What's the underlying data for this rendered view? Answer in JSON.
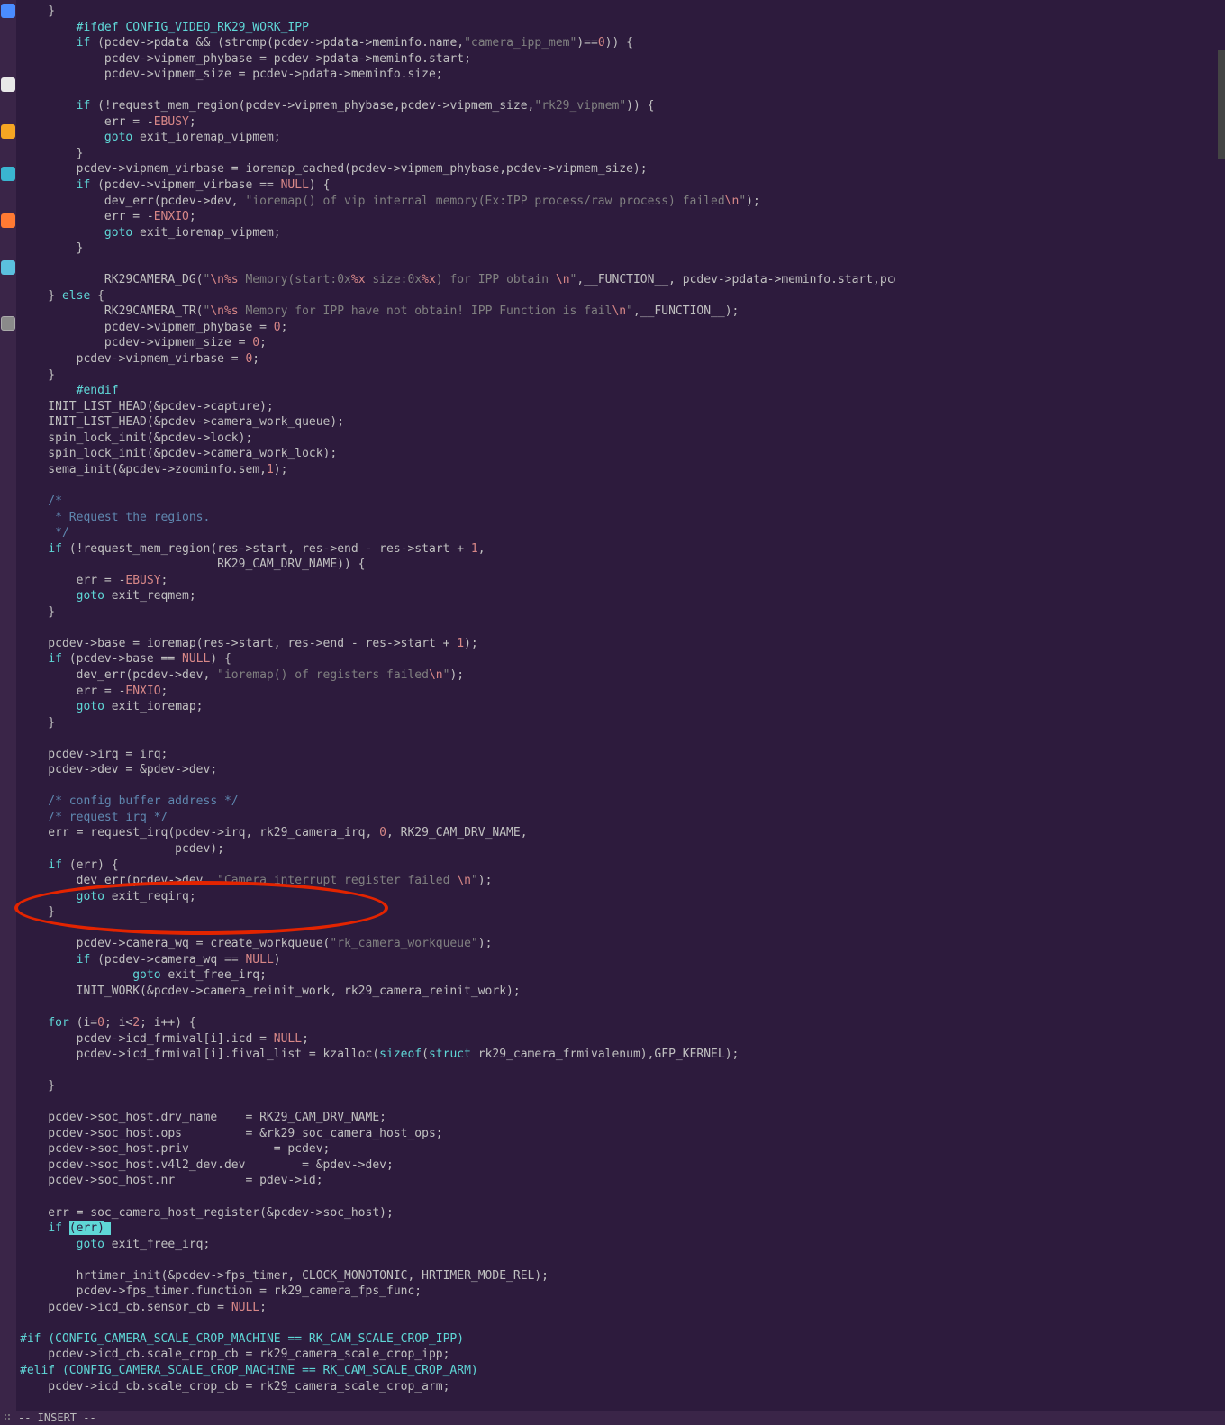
{
  "code": {
    "l01": "    }",
    "l02p": "        ",
    "l02d": "#ifdef",
    "l02s": " CONFIG_VIDEO_RK29_WORK_IPP",
    "l03a": "        ",
    "l03k": "if",
    "l03b": " (pcdev->pdata && (strcmp(pcdev->pdata->meminfo.name,",
    "l03s": "\"camera_ipp_mem\"",
    "l03c": ")==",
    "l03n": "0",
    "l03d": ")) {",
    "l04": "            pcdev->vipmem_phybase = pcdev->pdata->meminfo.start;",
    "l05": "            pcdev->vipmem_size = pcdev->pdata->meminfo.size;",
    "l06": "",
    "l07a": "        ",
    "l07k": "if",
    "l07b": " (!request_mem_region(pcdev->vipmem_phybase,pcdev->vipmem_size,",
    "l07s": "\"rk29_vipmem\"",
    "l07c": ")) {",
    "l08a": "            err = -",
    "l08c": "EBUSY",
    "l08b": ";",
    "l09a": "            ",
    "l09k": "goto",
    "l09b": " exit_ioremap_vipmem;",
    "l10": "        }",
    "l11": "        pcdev->vipmem_virbase = ioremap_cached(pcdev->vipmem_phybase,pcdev->vipmem_size);",
    "l12a": "        ",
    "l12k": "if",
    "l12b": " (pcdev->vipmem_virbase == ",
    "l12c": "NULL",
    "l12d": ") {",
    "l13a": "            dev_err(pcdev->dev, ",
    "l13s": "\"ioremap() of vip internal memory(Ex:IPP process/raw process) failed",
    "l13e": "\\n",
    "l13f": "\"",
    "l13b": ");",
    "l14a": "            err = -",
    "l14c": "ENXIO",
    "l14b": ";",
    "l15a": "            ",
    "l15k": "goto",
    "l15b": " exit_ioremap_vipmem;",
    "l16": "        }",
    "l17": "",
    "l18a": "            RK29CAMERA_DG(",
    "l18s1": "\"",
    "l18e1": "\\n",
    "l18s2": "%s",
    "l18s3": " Memory(start:0x",
    "l18s4": "%x",
    "l18s5": " size:0x",
    "l18s6": "%x",
    "l18s7": ") for IPP obtain ",
    "l18e2": "\\n",
    "l18s8": "\"",
    "l18b": ",__FUNCTION__, pcdev->pdata->meminfo.start,pcdev->pdata->memin",
    "l19a": "    } ",
    "l19k": "else",
    "l19b": " {",
    "l20a": "            RK29CAMERA_TR(",
    "l20s1": "\"",
    "l20e1": "\\n",
    "l20s2": "%s",
    "l20s3": " Memory for IPP have not obtain! IPP Function is fail",
    "l20e2": "\\n",
    "l20s4": "\"",
    "l20b": ",__FUNCTION__);",
    "l21a": "            pcdev->vipmem_phybase = ",
    "l21n": "0",
    "l21b": ";",
    "l22a": "            pcdev->vipmem_size = ",
    "l22n": "0",
    "l22b": ";",
    "l23a": "        pcdev->vipmem_virbase = ",
    "l23n": "0",
    "l23b": ";",
    "l24": "    }",
    "l25a": "        ",
    "l25d": "#endif",
    "l26": "    INIT_LIST_HEAD(&pcdev->capture);",
    "l27": "    INIT_LIST_HEAD(&pcdev->camera_work_queue);",
    "l28": "    spin_lock_init(&pcdev->lock);",
    "l29": "    spin_lock_init(&pcdev->camera_work_lock);",
    "l30a": "    sema_init(&pcdev->zoominfo.sem,",
    "l30n": "1",
    "l30b": ");",
    "l31": "",
    "l32": "    /*",
    "l33": "     * Request the regions.",
    "l34": "     */",
    "l35a": "    ",
    "l35k": "if",
    "l35b": " (!request_mem_region(res->start, res->end - res->start + ",
    "l35n": "1",
    "l35c": ",",
    "l36": "                            RK29_CAM_DRV_NAME)) {",
    "l37a": "        err = -",
    "l37c": "EBUSY",
    "l37b": ";",
    "l38a": "        ",
    "l38k": "goto",
    "l38b": " exit_reqmem;",
    "l39": "    }",
    "l40": "",
    "l41a": "    pcdev->base = ioremap(res->start, res->end - res->start + ",
    "l41n": "1",
    "l41b": ");",
    "l42a": "    ",
    "l42k": "if",
    "l42b": " (pcdev->base == ",
    "l42c": "NULL",
    "l42d": ") {",
    "l43a": "        dev_err(pcdev->dev, ",
    "l43s": "\"ioremap() of registers failed",
    "l43e": "\\n",
    "l43f": "\"",
    "l43b": ");",
    "l44a": "        err = -",
    "l44c": "ENXIO",
    "l44b": ";",
    "l45a": "        ",
    "l45k": "goto",
    "l45b": " exit_ioremap;",
    "l46": "    }",
    "l47": "",
    "l48": "    pcdev->irq = irq;",
    "l49": "    pcdev->dev = &pdev->dev;",
    "l50": "",
    "l51": "    /* config buffer address */",
    "l52": "    /* request irq */",
    "l53a": "    err = request_irq(pcdev->irq, rk29_camera_irq, ",
    "l53n": "0",
    "l53b": ", RK29_CAM_DRV_NAME,",
    "l54": "                      pcdev);",
    "l55a": "    ",
    "l55k": "if",
    "l55b": " (err) {",
    "l56a": "        dev_err(pcdev->dev, ",
    "l56s": "\"Camera interrupt register failed ",
    "l56e": "\\n",
    "l56f": "\"",
    "l56b": ");",
    "l57a": "        ",
    "l57k": "goto",
    "l57b": " exit_reqirq;",
    "l58": "    }",
    "l59": "",
    "l60a": "        pcdev->camera_wq = create_workqueue(",
    "l60s": "\"rk_camera_workqueue\"",
    "l60b": ");",
    "l61a": "        ",
    "l61k": "if",
    "l61b": " (pcdev->camera_wq == ",
    "l61c": "NULL",
    "l61d": ")",
    "l62a": "                ",
    "l62k": "goto",
    "l62b": " exit_free_irq;",
    "l63": "        INIT_WORK(&pcdev->camera_reinit_work, rk29_camera_reinit_work);",
    "l64": "",
    "l65a": "    ",
    "l65k": "for",
    "l65b": " (i=",
    "l65n1": "0",
    "l65c": "; i<",
    "l65n2": "2",
    "l65d": "; i++) {",
    "l66a": "        pcdev->icd_frmival[i].icd = ",
    "l66c": "NULL",
    "l66b": ";",
    "l67a": "        pcdev->icd_frmival[i].fival_list = kzalloc(",
    "l67k1": "sizeof",
    "l67b": "(",
    "l67k2": "struct",
    "l67c": " rk29_camera_frmivalenum),GFP_KERNEL);",
    "l68": "",
    "l69": "    }",
    "l70": "",
    "l71": "    pcdev->soc_host.drv_name    = RK29_CAM_DRV_NAME;",
    "l72": "    pcdev->soc_host.ops         = &rk29_soc_camera_host_ops;",
    "l73": "    pcdev->soc_host.priv            = pcdev;",
    "l74": "    pcdev->soc_host.v4l2_dev.dev        = &pdev->dev;",
    "l75": "    pcdev->soc_host.nr          = pdev->id;",
    "l76": "",
    "l77": "    err = soc_camera_host_register(&pcdev->soc_host);",
    "l78a": "    ",
    "l78k": "if",
    "l78b": " ",
    "l78c": "(err)",
    "l79a": "        ",
    "l79k": "goto",
    "l79b": " exit_free_irq;",
    "l80": "",
    "l81": "        hrtimer_init(&pcdev->fps_timer, CLOCK_MONOTONIC, HRTIMER_MODE_REL);",
    "l82": "        pcdev->fps_timer.function = rk29_camera_fps_func;",
    "l83a": "    pcdev->icd_cb.sensor_cb = ",
    "l83c": "NULL",
    "l83b": ";",
    "l84": "",
    "l85a": "#if",
    "l85b": " (CONFIG_CAMERA_SCALE_CROP_MACHINE == RK_CAM_SCALE_CROP_IPP)",
    "l86": "    pcdev->icd_cb.scale_crop_cb = rk29_camera_scale_crop_ipp;",
    "l87a": "#elif",
    "l87b": " (CONFIG_CAMERA_SCALE_CROP_MACHINE == RK_CAM_SCALE_CROP_ARM)",
    "l88": "    pcdev->icd_cb.scale_crop_cb = rk29_camera_scale_crop_arm;"
  },
  "status": "-- INSERT --"
}
